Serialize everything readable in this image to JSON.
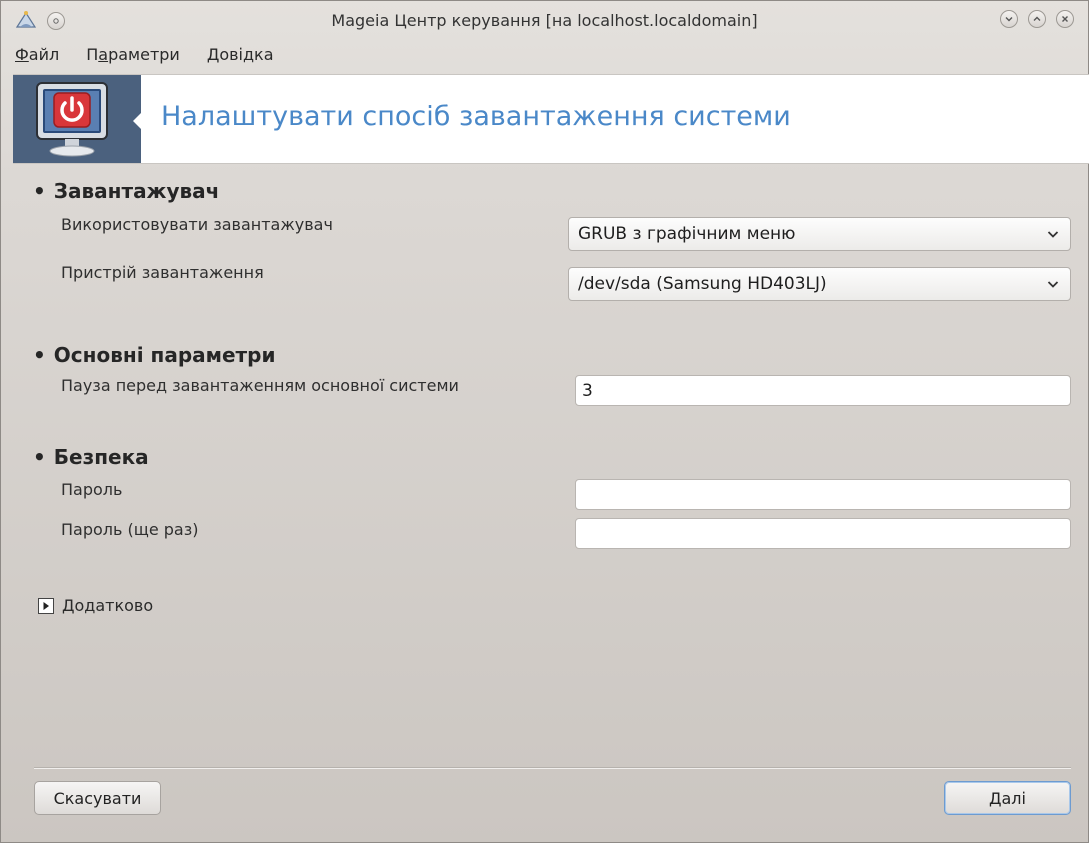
{
  "window": {
    "title": "Mageia Центр керування  [на localhost.localdomain]"
  },
  "menu": {
    "items": [
      {
        "accel": "Ф",
        "rest": "айл"
      },
      {
        "pre": "П",
        "accel": "а",
        "rest": "раметри"
      },
      {
        "accel": "Д",
        "rest": "овідка"
      }
    ]
  },
  "banner": {
    "title": "Налаштувати спосіб завантаження системи",
    "icon": "power-monitor-icon"
  },
  "sections": {
    "bootloader": {
      "title": "Завантажувач",
      "use_label": "Використовувати завантажувач",
      "use_value": "GRUB з графічним меню",
      "device_label": "Пристрій завантаження",
      "device_value": "/dev/sda (Samsung HD403LJ)"
    },
    "main": {
      "title": "Основні параметри",
      "delay_label": "Пауза перед завантаженням основної системи",
      "delay_value": "3"
    },
    "security": {
      "title": "Безпека",
      "password_label": "Пароль",
      "password_value": "",
      "password_again_label": "Пароль (ще раз)",
      "password_again_value": ""
    }
  },
  "advanced": {
    "label": "Додатково"
  },
  "buttons": {
    "cancel": "Скасувати",
    "next": "Далі"
  },
  "colors": {
    "banner_title": "#4a88c8",
    "banner_icon_bg": "#4b617e",
    "default_button_border": "#6d9bd0"
  }
}
